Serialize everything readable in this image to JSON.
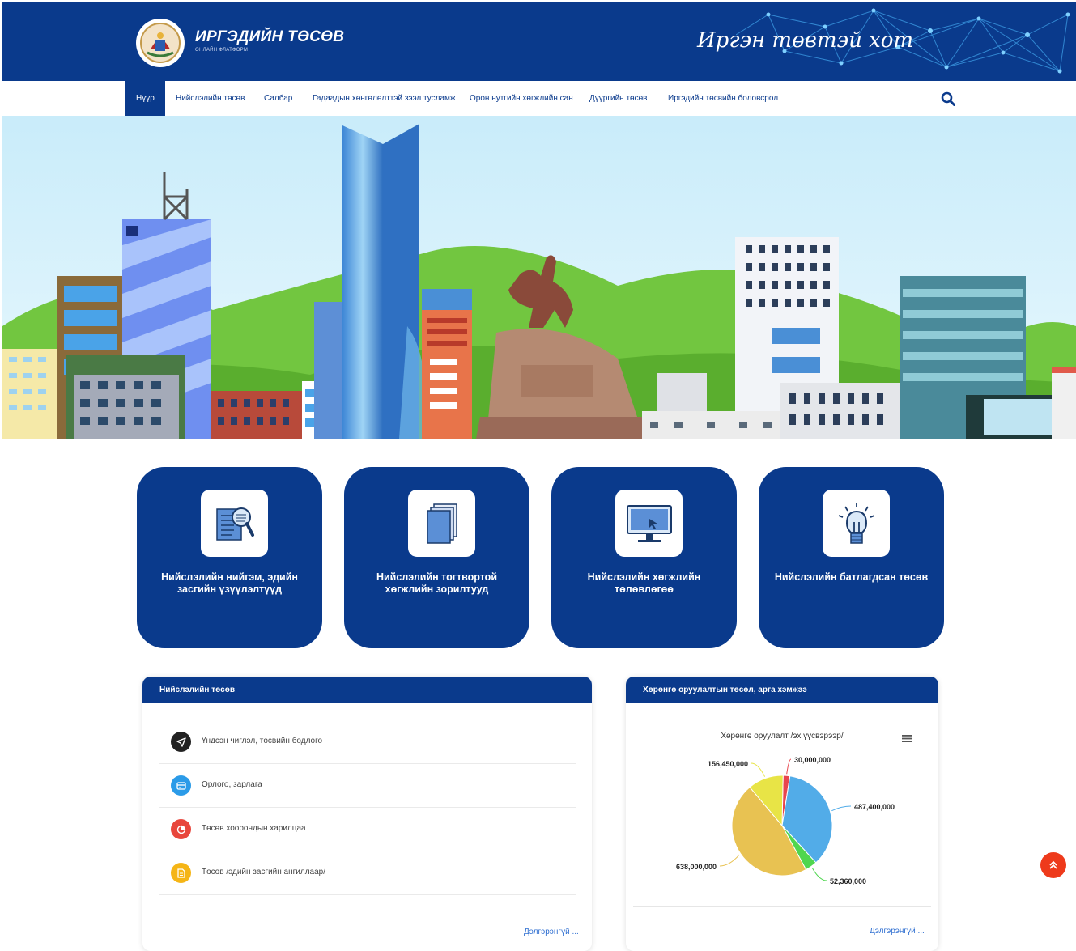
{
  "brand": {
    "title": "ИРГЭДИЙН ТӨСӨВ",
    "subtitle": "ОНЛАЙН ФЛАТФОРМ",
    "slogan": "Иргэн төвтэй хот"
  },
  "nav": {
    "items": [
      "Нүүр",
      "Нийслэлийн төсөв",
      "Салбар",
      "Гадаадын хөнгөлөлттэй зээл тусламж",
      "Орон нутгийн хөгжлийн сан",
      "Дүүргийн төсөв",
      "Иргэдийн төсвийн боловсрол"
    ],
    "active_index": 0
  },
  "cards": [
    {
      "label": "Нийслэлийн нийгэм, эдийн засгийн үзүүлэлтүүд",
      "icon": "search-document-icon"
    },
    {
      "label": "Нийслэлийн тогтвортой хөгжлийн зорилтууд",
      "icon": "documents-icon"
    },
    {
      "label": "Нийслэлийн хөгжлийн төлөвлөгөө",
      "icon": "monitor-icon"
    },
    {
      "label": "Нийслэлийн батлагдсан төсөв",
      "icon": "lightbulb-icon"
    }
  ],
  "budget_panel": {
    "title": "Нийслэлийн төсөв",
    "items": [
      {
        "label": "Үндсэн чиглэл, төсвийн бодлого",
        "color": "#222222",
        "icon": "send-icon"
      },
      {
        "label": "Орлого, зарлага",
        "color": "#2b9be8",
        "icon": "card-icon"
      },
      {
        "label": "Төсөв хоорондын харилцаа",
        "color": "#e8463c",
        "icon": "pie-icon"
      },
      {
        "label": "Төсөв /эдийн засгийн ангиллаар/",
        "color": "#f5b516",
        "icon": "file-icon"
      }
    ],
    "more": "Дэлгэрэнгүй ..."
  },
  "invest_panel": {
    "title": "Хөрөнгө оруулалтын төсөл, арга хэмжээ",
    "more": "Дэлгэрэнгүй ..."
  },
  "chart_data": {
    "type": "pie",
    "title": "Хөрөнгө оруулалт /эх үүсвэрээр/",
    "slices": [
      {
        "label": "30,000,000",
        "value": 30000000,
        "color": "#e8464e"
      },
      {
        "label": "487,400,000",
        "value": 487400000,
        "color": "#52ace8"
      },
      {
        "label": "52,360,000",
        "value": 52360000,
        "color": "#4fd64f"
      },
      {
        "label": "638,000,000",
        "value": 638000000,
        "color": "#e8c252"
      },
      {
        "label": "156,450,000",
        "value": 156450000,
        "color": "#e8e446"
      }
    ]
  }
}
